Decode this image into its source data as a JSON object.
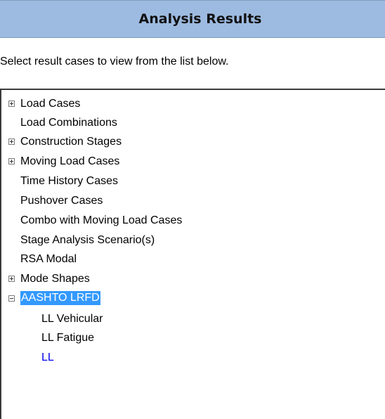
{
  "header": {
    "title": "Analysis Results"
  },
  "instruction": "Select result cases to view from the list below.",
  "tree": {
    "items": [
      {
        "label": "Load Cases",
        "expander": "plus"
      },
      {
        "label": "Load Combinations"
      },
      {
        "label": "Construction Stages",
        "expander": "plus"
      },
      {
        "label": "Moving Load Cases",
        "expander": "plus"
      },
      {
        "label": "Time History Cases"
      },
      {
        "label": "Pushover Cases"
      },
      {
        "label": "Combo with Moving Load Cases"
      },
      {
        "label": "Stage Analysis Scenario(s)"
      },
      {
        "label": "RSA Modal"
      },
      {
        "label": "Mode Shapes",
        "expander": "plus"
      },
      {
        "label": "AASHTO LRFD",
        "expander": "minus",
        "selected": true
      },
      {
        "label": "LL Vehicular",
        "child": true
      },
      {
        "label": "LL Fatigue",
        "child": true
      },
      {
        "label": "LL",
        "child": true,
        "color": "#0000ee"
      }
    ]
  },
  "colors": {
    "header_bg": "#9dbbe1",
    "selection": "#3399ff",
    "link": "#0000ee"
  }
}
